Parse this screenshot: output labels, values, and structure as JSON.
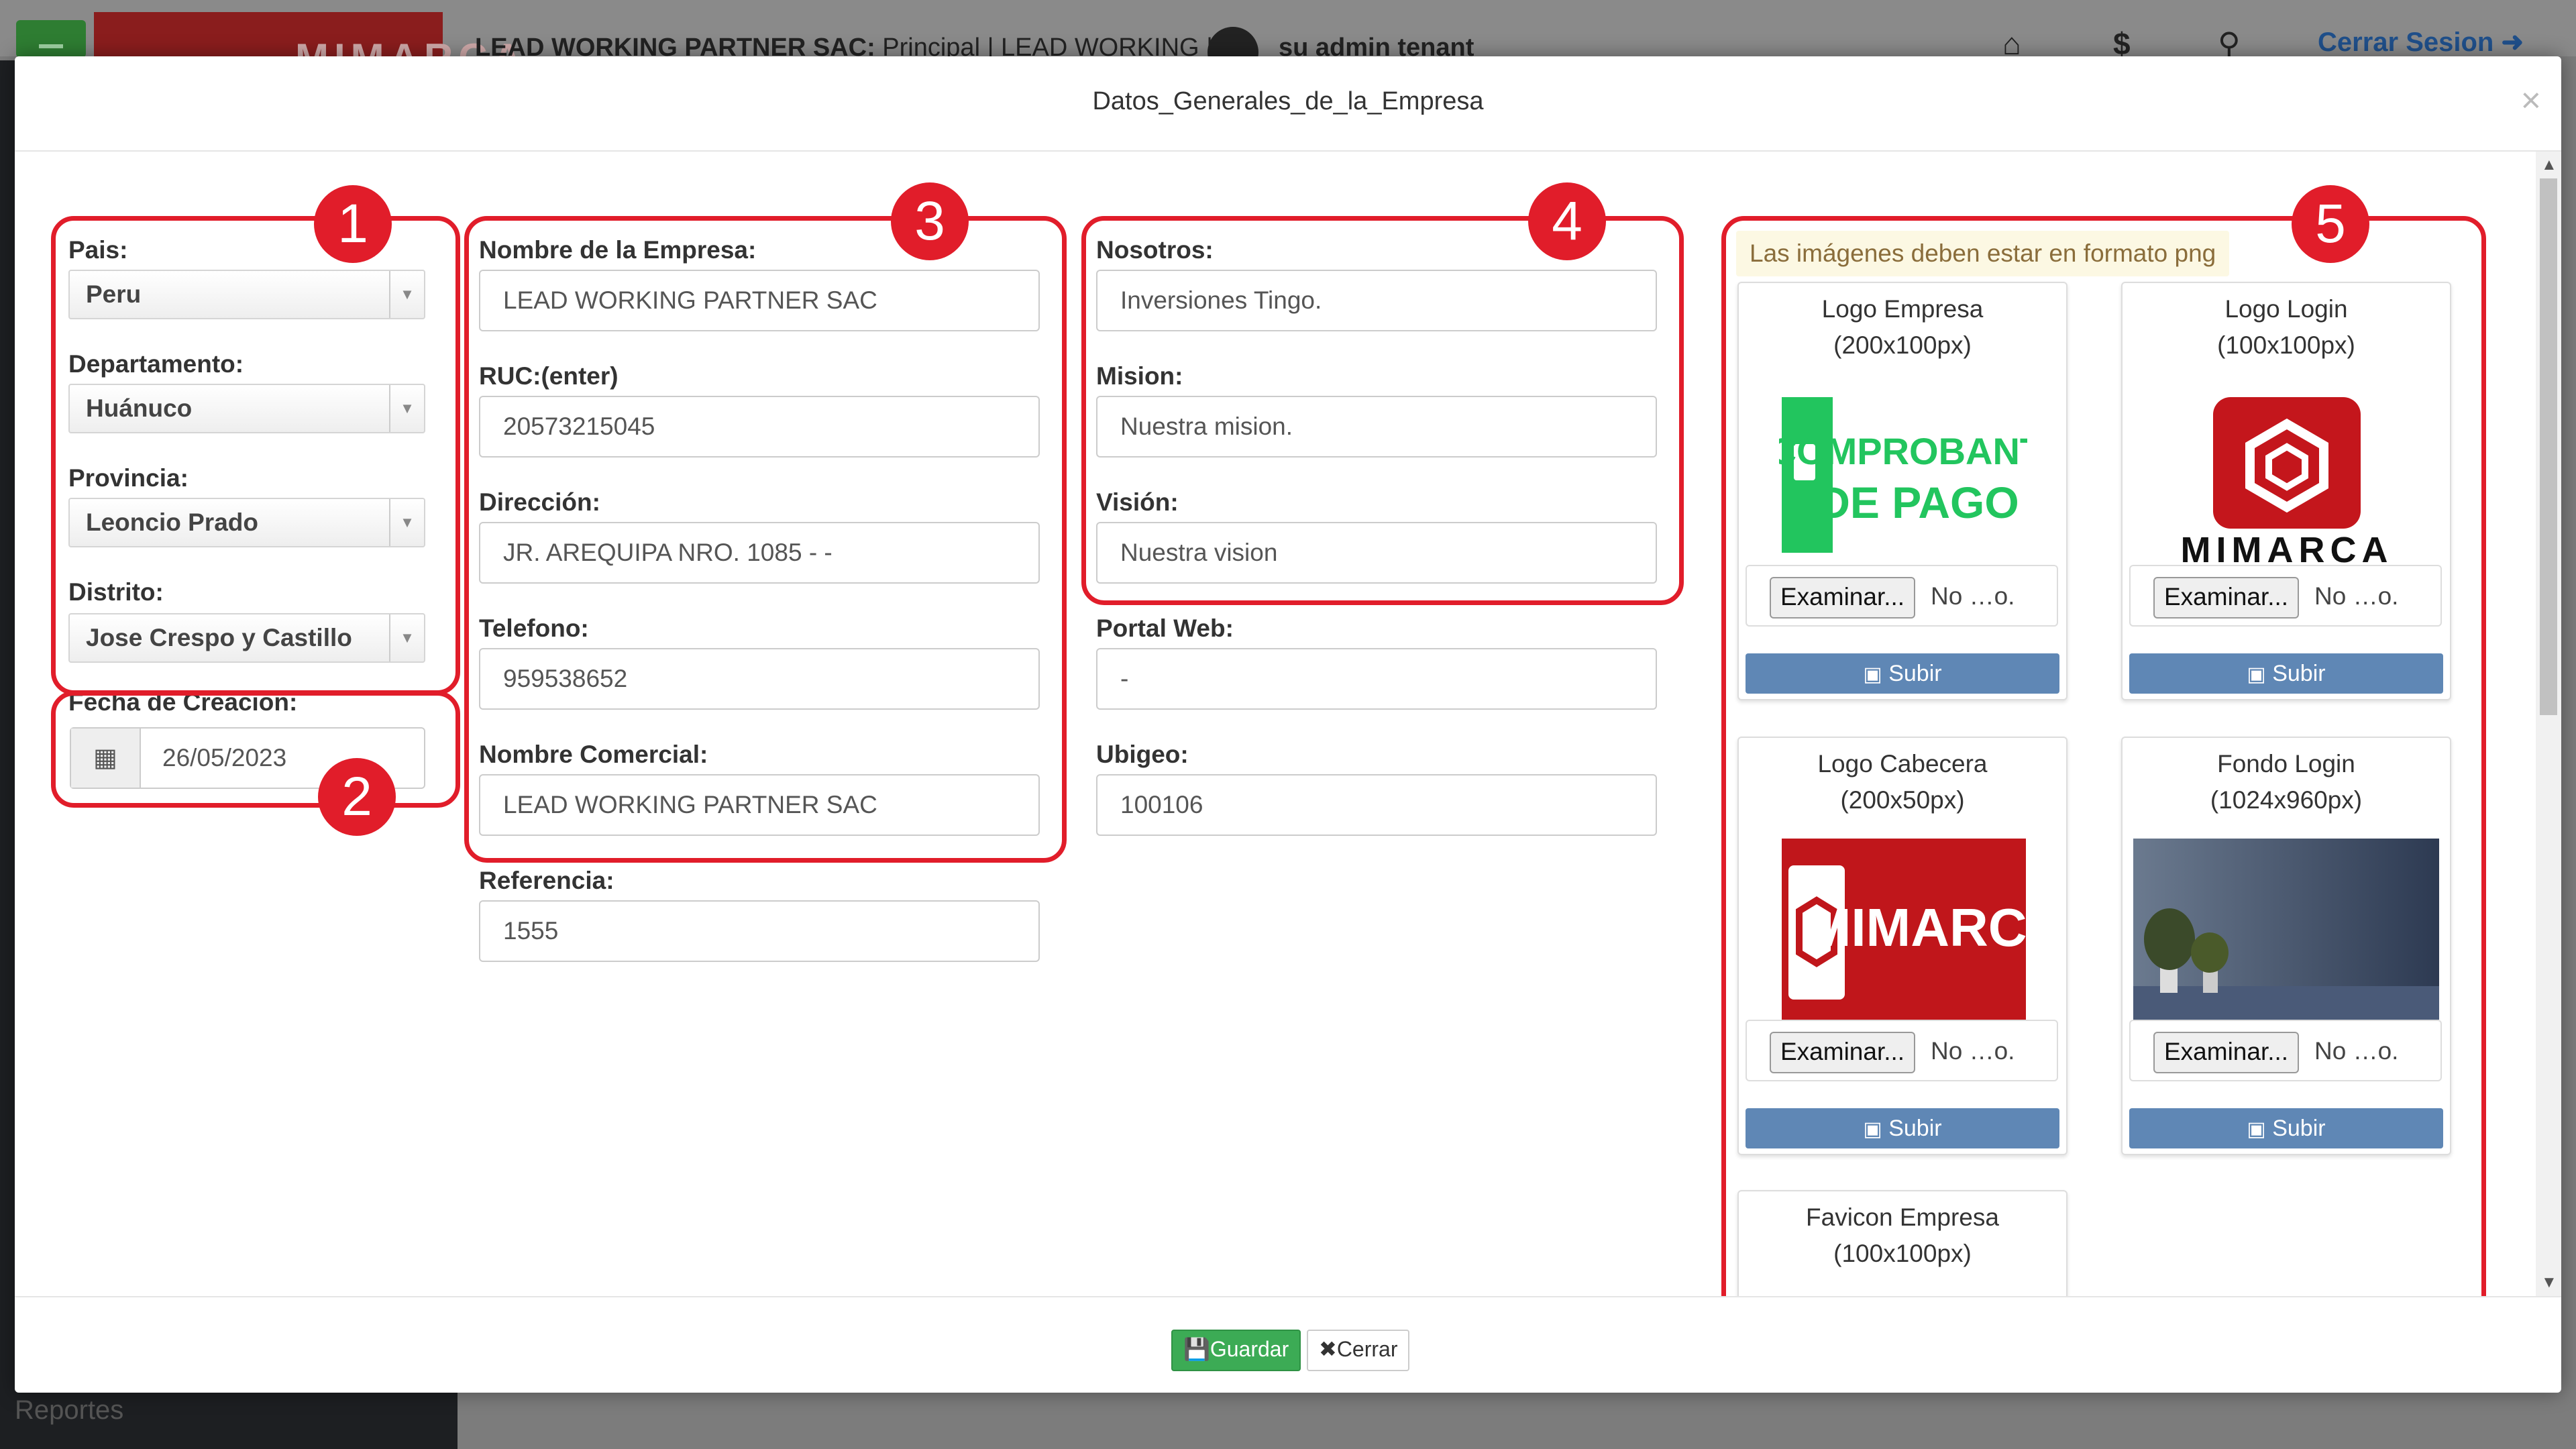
{
  "app": {
    "brand": "MIMARCA",
    "company_line_bold": "LEAD WORKING PARTNER SAC:",
    "company_line_rest": " Principal | LEAD WORKING |",
    "user": "su admin tenant",
    "logout": "Cerrar Sesion",
    "sidebar_item": "Reportes"
  },
  "modal": {
    "title": "Datos_Generales_de_la_Empresa",
    "close": "×",
    "save_label": "Guardar",
    "close_label": "Cerrar"
  },
  "location": {
    "pais_label": "Pais:",
    "pais_value": "Peru",
    "departamento_label": "Departamento:",
    "departamento_value": "Huánuco",
    "provincia_label": "Provincia:",
    "provincia_value": "Leoncio Prado",
    "distrito_label": "Distrito:",
    "distrito_value": "Jose Crespo y Castillo",
    "fecha_label": "Fecha de Creacion:",
    "fecha_value": "26/05/2023"
  },
  "company": {
    "nombre_label": "Nombre de la Empresa:",
    "nombre_value": "LEAD WORKING PARTNER SAC",
    "ruc_label": "RUC:(enter)",
    "ruc_value": "20573215045",
    "direccion_label": "Dirección:",
    "direccion_value": "JR. AREQUIPA NRO. 1085 - -",
    "telefono_label": "Telefono:",
    "telefono_value": "959538652",
    "comercial_label": "Nombre Comercial:",
    "comercial_value": "LEAD WORKING PARTNER SAC",
    "referencia_label": "Referencia:",
    "referencia_value": "1555"
  },
  "about": {
    "nosotros_label": "Nosotros:",
    "nosotros_value": "Inversiones Tingo.",
    "mision_label": "Mision:",
    "mision_value": "Nuestra mision.",
    "vision_label": "Visión:",
    "vision_value": "Nuestra vision",
    "portal_label": "Portal Web:",
    "portal_value": "-",
    "ubigeo_label": "Ubigeo:",
    "ubigeo_value": "100106"
  },
  "images": {
    "warning": "Las imágenes deben estar en formato png",
    "browse_label": "Examinar...",
    "file_none": "No …o.",
    "upload_label": "Subir",
    "cards": [
      {
        "title": "Logo Empresa",
        "size": "(200x100px)",
        "img_line1": "COMPROBANTE",
        "img_line2": "DE PAGO"
      },
      {
        "title": "Logo Login",
        "size": "(100x100px)",
        "img_line1": "MIMARCA"
      },
      {
        "title": "Logo Cabecera",
        "size": "(200x50px)",
        "img_line1": "MIMARCA"
      },
      {
        "title": "Fondo Login",
        "size": "(1024x960px)"
      },
      {
        "title": "Favicon Empresa",
        "size": "(100x100px)"
      }
    ]
  },
  "annotations": [
    "1",
    "2",
    "3",
    "4",
    "5"
  ],
  "colors": {
    "highlight": "#e11d2a",
    "save_green": "#3cab55",
    "upload_blue": "#5f87b5",
    "brand_red": "#c4161c"
  }
}
